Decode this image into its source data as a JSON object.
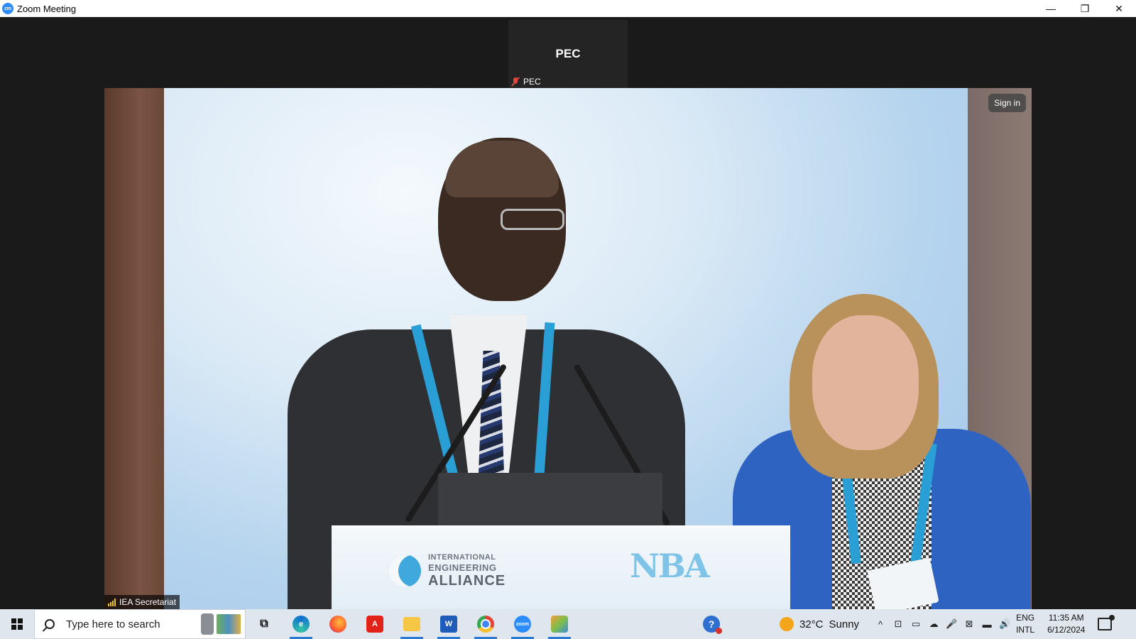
{
  "window": {
    "title": "Zoom Meeting",
    "app_icon_text": "zm",
    "controls": {
      "minimize": "—",
      "restore": "❐",
      "close": "✕"
    }
  },
  "meeting": {
    "thumbnail": {
      "display_name": "PEC",
      "name_tag": "PEC",
      "mic_state": "muted"
    },
    "main_video": {
      "participant_label": "IEA Secretariat",
      "sign_in_label": "Sign in",
      "podium_logos": {
        "iea_line1": "INTERNATIONAL",
        "iea_line2": "ENGINEERING",
        "iea_line3": "ALLIANCE",
        "nba_text": "NBA"
      }
    }
  },
  "taskbar": {
    "search_placeholder": "Type here to search",
    "pinned": [
      {
        "name": "task-view",
        "label": "⧉"
      },
      {
        "name": "edge",
        "label": "e"
      },
      {
        "name": "firefox",
        "label": ""
      },
      {
        "name": "acrobat",
        "label": "A"
      },
      {
        "name": "file-explorer",
        "label": ""
      },
      {
        "name": "word",
        "label": "W"
      },
      {
        "name": "chrome",
        "label": ""
      },
      {
        "name": "zoom",
        "label": "zoom"
      },
      {
        "name": "paint",
        "label": ""
      }
    ],
    "help_label": "?",
    "weather": {
      "temperature": "32°C",
      "condition": "Sunny"
    },
    "tray_icons": [
      "^",
      "⊡",
      "▭",
      "☁",
      "🎤",
      "⊠",
      "▬",
      "🔊"
    ],
    "language": {
      "line1": "ENG",
      "line2": "INTL"
    },
    "clock": {
      "time": "11:35 AM",
      "date": "6/12/2024"
    }
  },
  "colors": {
    "accent": "#2d8cff",
    "taskbar_active": "#2b7bd3",
    "muted_red": "#e0473f"
  }
}
